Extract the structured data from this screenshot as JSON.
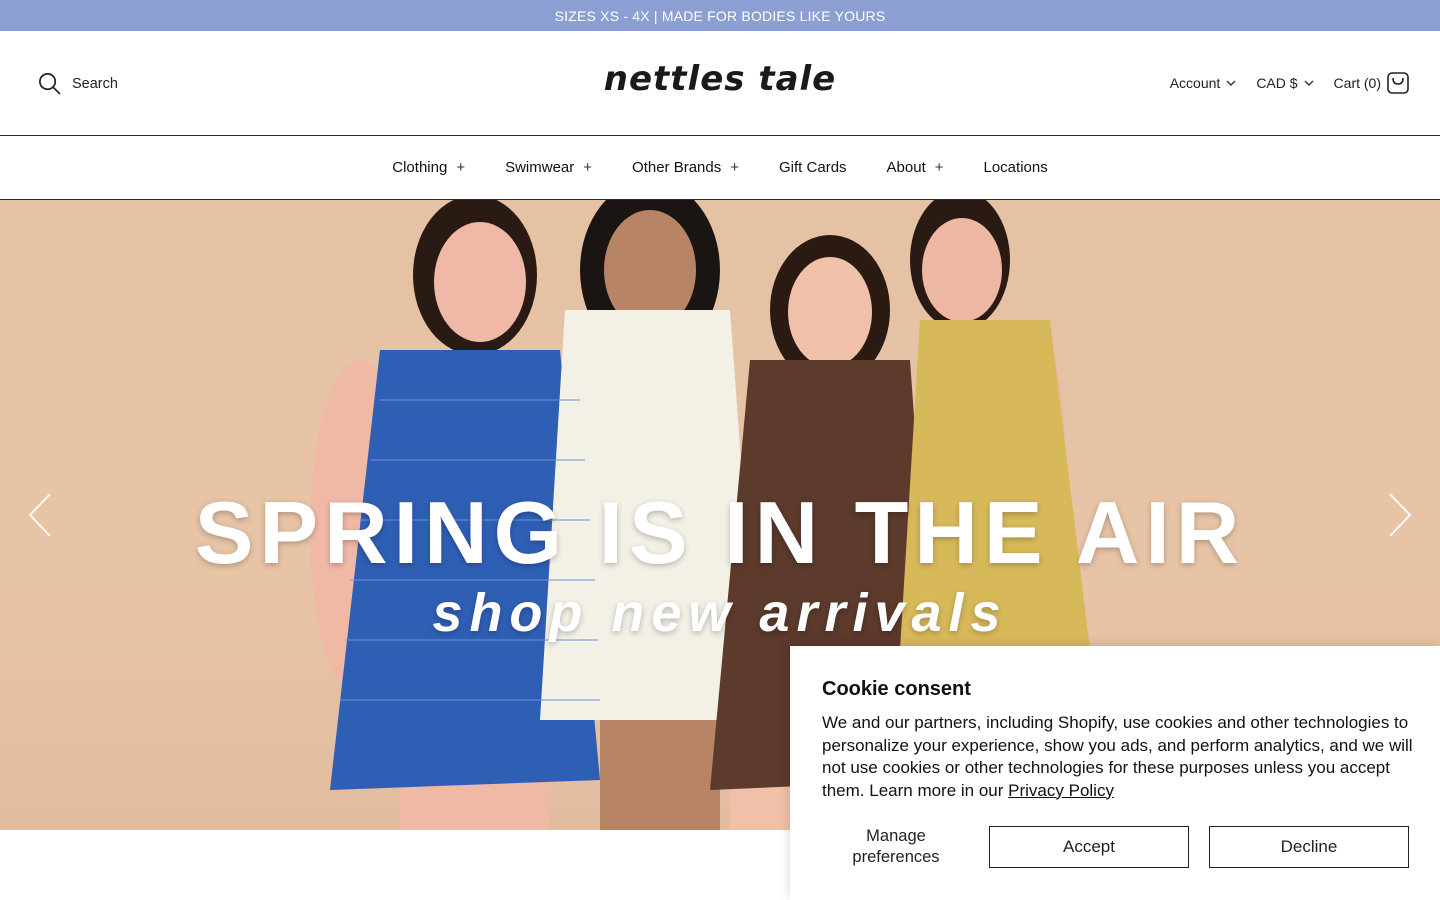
{
  "announcement": {
    "text": "SIZES XS - 4X | MADE FOR BODIES LIKE YOURS"
  },
  "header": {
    "search_label": "Search",
    "logo": "nettles tale",
    "account_label": "Account",
    "currency_label": "CAD $",
    "cart_label": "Cart (0)"
  },
  "nav": {
    "items": [
      {
        "label": "Clothing",
        "plus": "+"
      },
      {
        "label": "Swimwear",
        "plus": "+"
      },
      {
        "label": "Other Brands",
        "plus": "+"
      },
      {
        "label": "Gift Cards"
      },
      {
        "label": "About",
        "plus": "+"
      },
      {
        "label": "Locations"
      }
    ]
  },
  "hero": {
    "title": "SPRING IS IN THE AIR",
    "subtitle": "shop new arrivals",
    "background_color": "#e6c2a4"
  },
  "cookie": {
    "title": "Cookie consent",
    "body": "We and our partners, including Shopify, use cookies and other technologies to personalize your experience, show you ads, and perform analytics, and we will not use cookies or other technologies for these purposes unless you accept them. Learn more in our ",
    "privacy_link": "Privacy Policy",
    "manage_label_1": "Manage",
    "manage_label_2": "preferences",
    "accept_label": "Accept",
    "decline_label": "Decline"
  },
  "colors": {
    "announcement_bg": "#8c9fd3",
    "dress_blue": "#2f5fb5",
    "dress_white": "#f3f0e6",
    "dress_brown": "#5c3a2c",
    "dress_yellow": "#d8b95a"
  }
}
